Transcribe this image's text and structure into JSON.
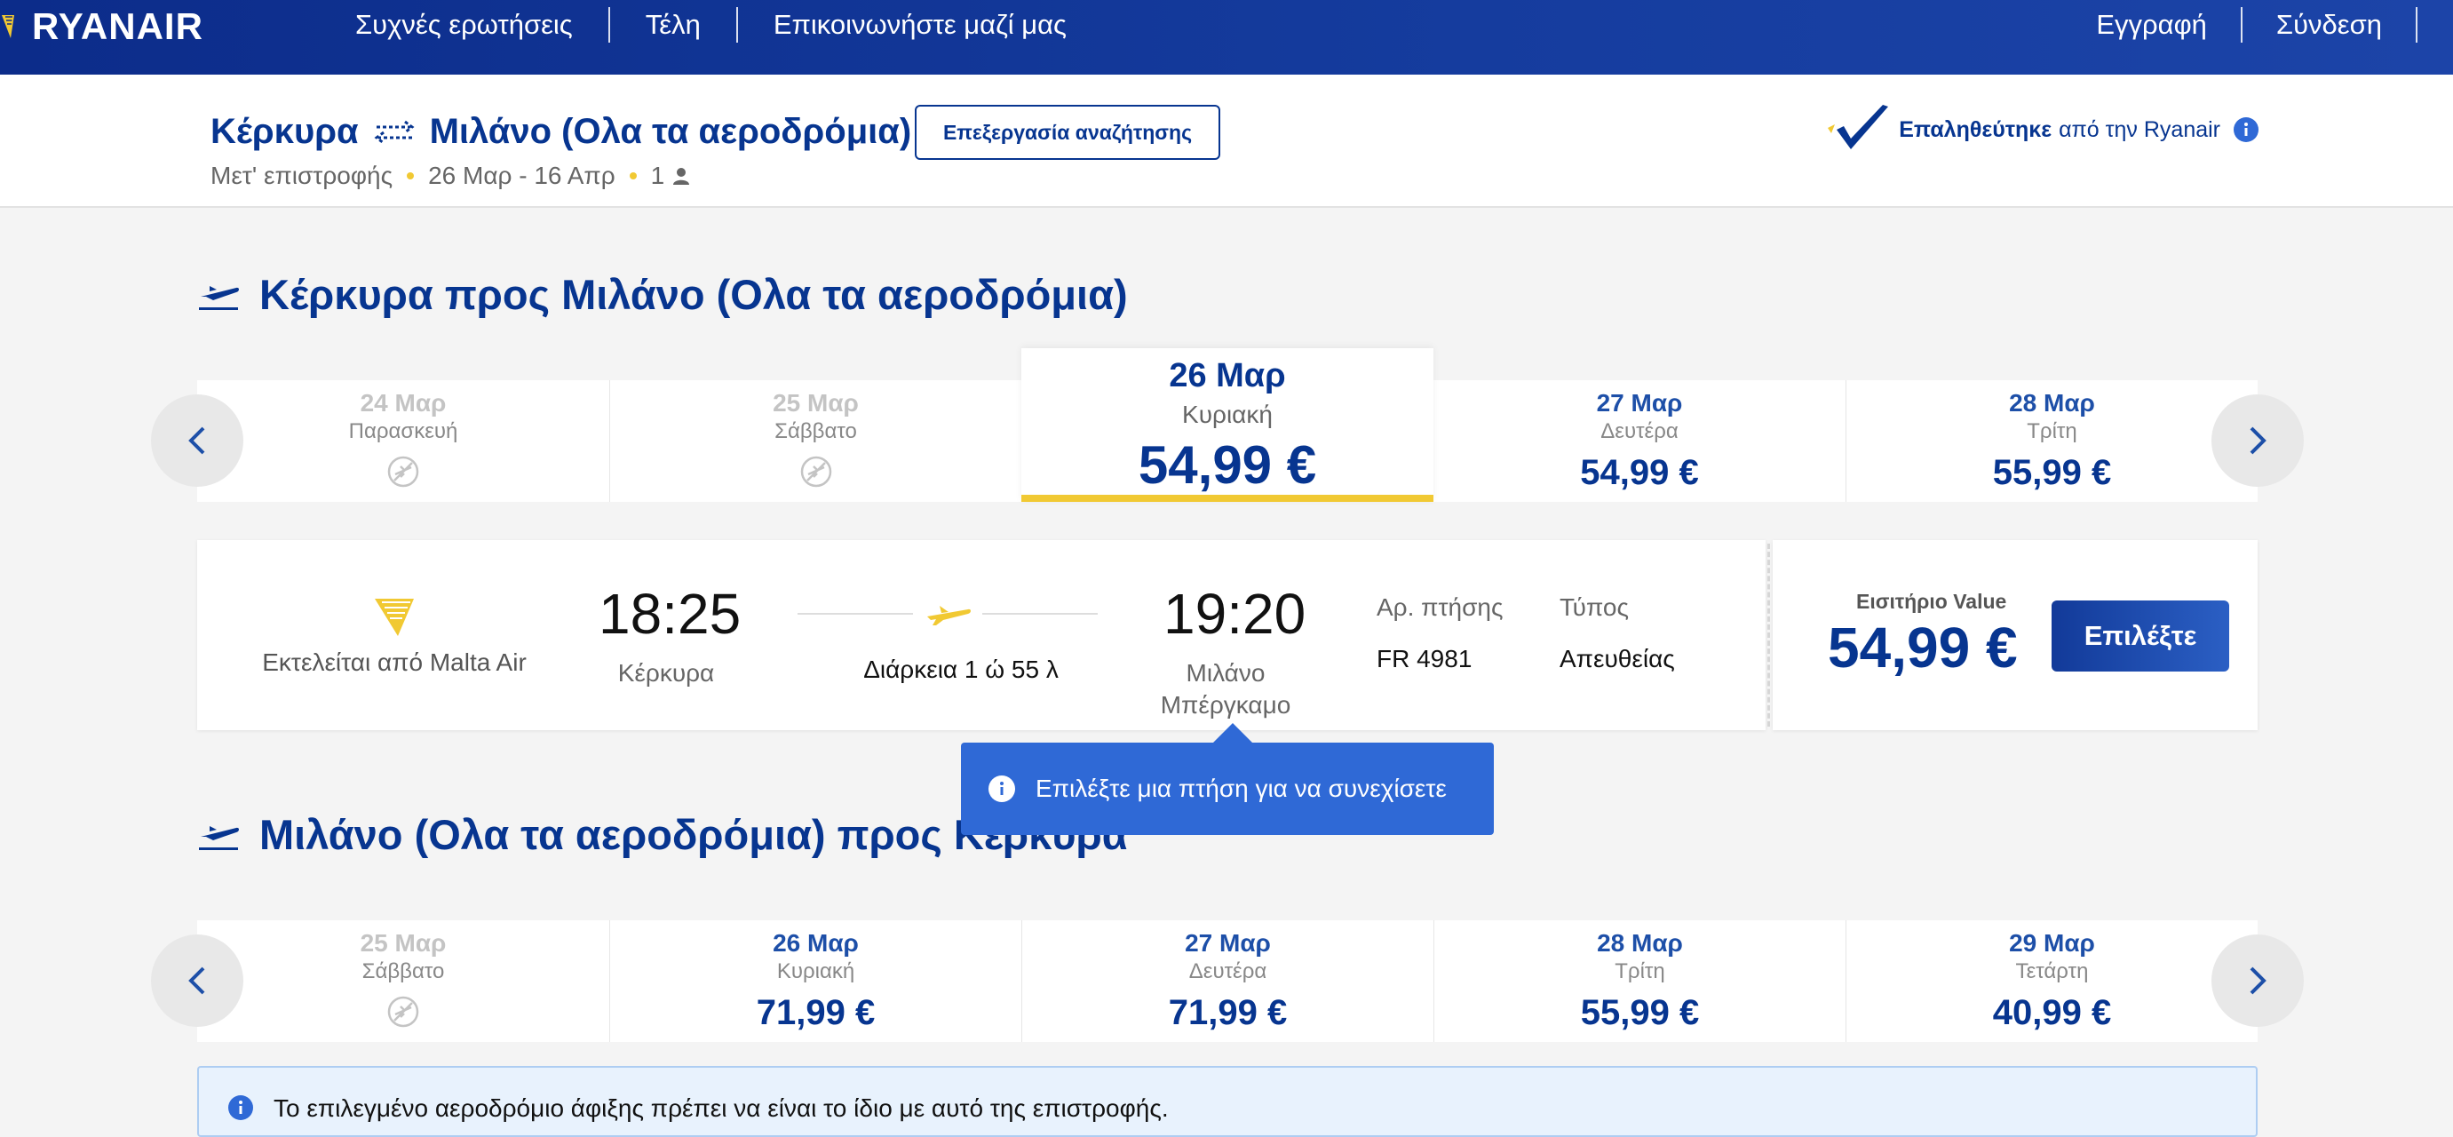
{
  "nav": {
    "brand": "RYANAIR",
    "links": [
      "Συχνές ερωτήσεις",
      "Τέλη",
      "Επικοινωνήστε μαζί μας"
    ],
    "right_links": [
      "Εγγραφή",
      "Σύνδεση"
    ]
  },
  "search": {
    "origin": "Κέρκυρα",
    "destination": "Μιλάνο (Ολα τα αεροδρόμια)",
    "edit_label": "Επεξεργασία αναζήτησης",
    "trip_type": "Μετ' επιστροφής",
    "dates": "26 Μαρ - 16 Απρ",
    "passengers": "1",
    "verified_strong": "Επαληθεύτηκε",
    "verified_rest": "από την Ryanair"
  },
  "outbound": {
    "title": "Κέρκυρα προς Μιλάνο (Ολα τα αεροδρόμια)",
    "dates": [
      {
        "date": "24 Μαρ",
        "weekday": "Παρασκευή",
        "price": null,
        "available": false
      },
      {
        "date": "25 Μαρ",
        "weekday": "Σάββατο",
        "price": null,
        "available": false
      },
      {
        "date": "26 Μαρ",
        "weekday": "Κυριακή",
        "price": "54,99 €",
        "available": true,
        "selected": true
      },
      {
        "date": "27 Μαρ",
        "weekday": "Δευτέρα",
        "price": "54,99 €",
        "available": true
      },
      {
        "date": "28 Μαρ",
        "weekday": "Τρίτη",
        "price": "55,99 €",
        "available": true
      }
    ]
  },
  "flight": {
    "operated_by": "Εκτελείται από Malta Air",
    "depart_time": "18:25",
    "depart_place": "Κέρκυρα",
    "duration": "Διάρκεια 1 ώ 55 λ",
    "arrive_time": "19:20",
    "arrive_place_1": "Μιλάνο",
    "arrive_place_2": "Μπέργκαμο",
    "flight_no_label": "Αρ. πτήσης",
    "flight_no": "FR 4981",
    "type_label": "Τύπος",
    "type": "Απευθείας",
    "fare_label": "Εισιτήριο Value",
    "fare_price": "54,99 €",
    "select_label": "Επιλέξτε"
  },
  "tooltip": {
    "text": "Επιλέξτε μια πτήση για να συνεχίσετε"
  },
  "inbound": {
    "title": "Μιλάνο (Ολα τα αεροδρόμια) προς Κέρκυρα",
    "dates": [
      {
        "date": "25 Μαρ",
        "weekday": "Σάββατο",
        "price": null,
        "available": false
      },
      {
        "date": "26 Μαρ",
        "weekday": "Κυριακή",
        "price": "71,99 €",
        "available": true
      },
      {
        "date": "27 Μαρ",
        "weekday": "Δευτέρα",
        "price": "71,99 €",
        "available": true
      },
      {
        "date": "28 Μαρ",
        "weekday": "Τρίτη",
        "price": "55,99 €",
        "available": true
      },
      {
        "date": "29 Μαρ",
        "weekday": "Τετάρτη",
        "price": "40,99 €",
        "available": true
      }
    ]
  },
  "banner": {
    "text": "Το επιλεγμένο αεροδρόμιο άφιξης πρέπει να είναι το ίδιο με αυτό της επιστροφής."
  },
  "colors": {
    "brand_blue": "#073590",
    "accent_yellow": "#f1c933",
    "tooltip_blue": "#2f69d6"
  }
}
